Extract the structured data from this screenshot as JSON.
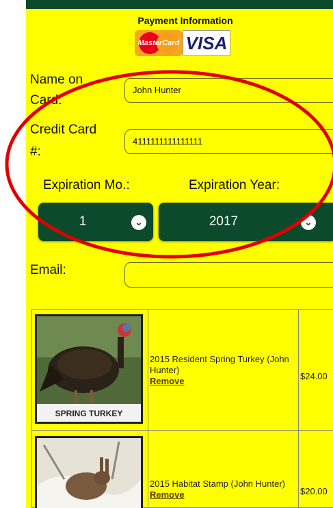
{
  "payment": {
    "title": "Payment Information",
    "mastercard_label": "MasterCard",
    "visa_label": "VISA"
  },
  "form": {
    "name_label_line1": "Name on",
    "name_label_line2": "Card:",
    "name_value": "John Hunter",
    "cc_label_line1": "Credit Card",
    "cc_label_line2": "#:",
    "cc_value": "4111111111111111",
    "exp_month_label": "Expiration Mo.:",
    "exp_year_label": "Expiration Year:",
    "exp_month_value": "1",
    "exp_year_value": "2017",
    "email_label": "Email:",
    "email_value": ""
  },
  "cart": {
    "items": [
      {
        "image_caption": "SPRING TURKEY",
        "description": "2015 Resident Spring Turkey (John Hunter)",
        "remove_label": "Remove",
        "price": "$24.00"
      },
      {
        "image_caption": "",
        "description": "2015 Habitat Stamp (John Hunter)",
        "remove_label": "Remove",
        "price": "$20.00"
      }
    ]
  },
  "colors": {
    "background": "#ffff00",
    "dark_green": "#0b4a2b",
    "annotation_red": "#e00000"
  }
}
